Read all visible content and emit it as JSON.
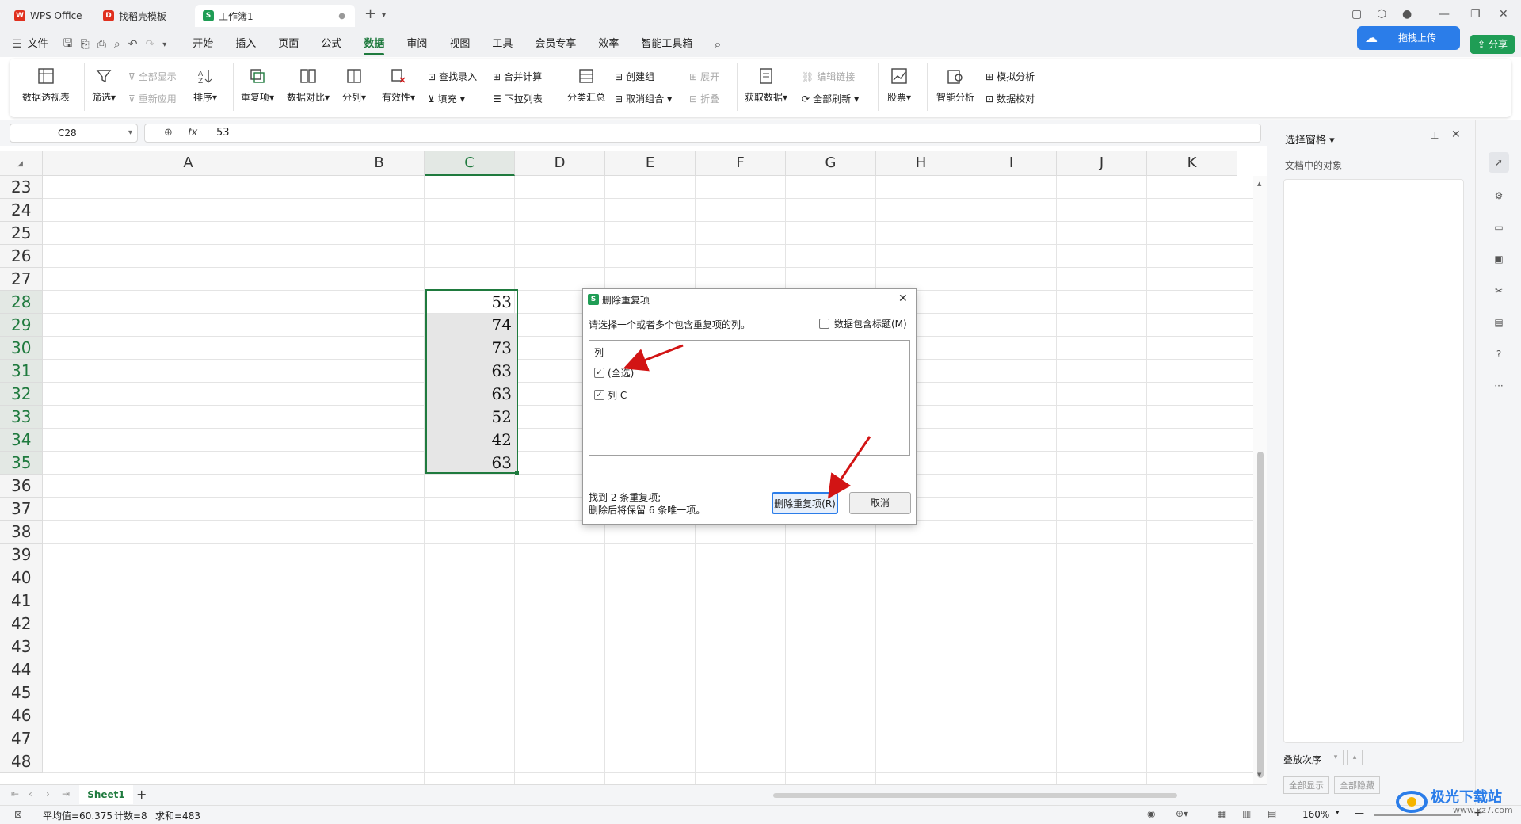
{
  "tabs": [
    {
      "label": "WPS Office"
    },
    {
      "label": "找稻壳模板"
    },
    {
      "label": "工作簿1"
    }
  ],
  "menu": {
    "file": "文件",
    "items": [
      "开始",
      "插入",
      "页面",
      "公式",
      "数据",
      "审阅",
      "视图",
      "工具",
      "会员专享",
      "效率",
      "智能工具箱"
    ],
    "active": "数据",
    "upload": "拖拽上传",
    "share": "分享"
  },
  "ribbon": {
    "pivot": "数据透视表",
    "filter": "筛选",
    "show_all": "全部显示",
    "reapply": "重新应用",
    "sort": "排序",
    "duplicates": "重复项",
    "compare": "数据对比",
    "split": "分列",
    "validity": "有效性",
    "lookup": "查找录入",
    "fill": "填充",
    "consolidate": "合并计算",
    "dropdown": "下拉列表",
    "subtotal": "分类汇总",
    "group": "创建组",
    "ungroup": "取消组合",
    "expand": "展开",
    "collapse": "折叠",
    "get_data": "获取数据",
    "edit_links": "编辑链接",
    "refresh_all": "全部刷新",
    "stocks": "股票",
    "smart_analysis": "智能分析",
    "whatif": "模拟分析",
    "verify": "数据校对"
  },
  "formula": {
    "cell_ref": "C28",
    "fx": "fx",
    "value": "53"
  },
  "columns": [
    "A",
    "B",
    "C",
    "D",
    "E",
    "F",
    "G",
    "H",
    "I",
    "J",
    "K"
  ],
  "rows": [
    "23",
    "24",
    "25",
    "26",
    "27",
    "28",
    "29",
    "30",
    "31",
    "32",
    "33",
    "34",
    "35",
    "36",
    "37",
    "38",
    "39",
    "40",
    "41",
    "42",
    "43",
    "44",
    "45",
    "46",
    "47",
    "48"
  ],
  "cells_c": [
    {
      "row": "28",
      "value": "53"
    },
    {
      "row": "29",
      "value": "74"
    },
    {
      "row": "30",
      "value": "73"
    },
    {
      "row": "31",
      "value": "63"
    },
    {
      "row": "32",
      "value": "63"
    },
    {
      "row": "33",
      "value": "52"
    },
    {
      "row": "34",
      "value": "42"
    },
    {
      "row": "35",
      "value": "63"
    }
  ],
  "sheet": {
    "name": "Sheet1"
  },
  "status": {
    "avg": "平均值=60.375",
    "count": "计数=8",
    "sum": "求和=483",
    "zoom": "160%"
  },
  "pane": {
    "title": "选择窗格",
    "subtitle": "文档中的对象",
    "order": "叠放次序",
    "show_all": "全部显示",
    "hide_all": "全部隐藏"
  },
  "dialog": {
    "title": "删除重复项",
    "instruction": "请选择一个或者多个包含重复项的列。",
    "header_checkbox": "数据包含标题(M)",
    "list_header": "列",
    "select_all": "(全选)",
    "col_c": "列 C",
    "found": "找到 2 条重复项;",
    "remain": "删除后将保留 6 条唯一项。",
    "delete_btn": "删除重复项(R)",
    "cancel_btn": "取消"
  },
  "watermark": "极光下载站",
  "watermark_url": "www.xz7.com",
  "colors": {
    "accent": "#1f7a3e",
    "arrow": "#d21414",
    "upload": "#2b7de9"
  }
}
